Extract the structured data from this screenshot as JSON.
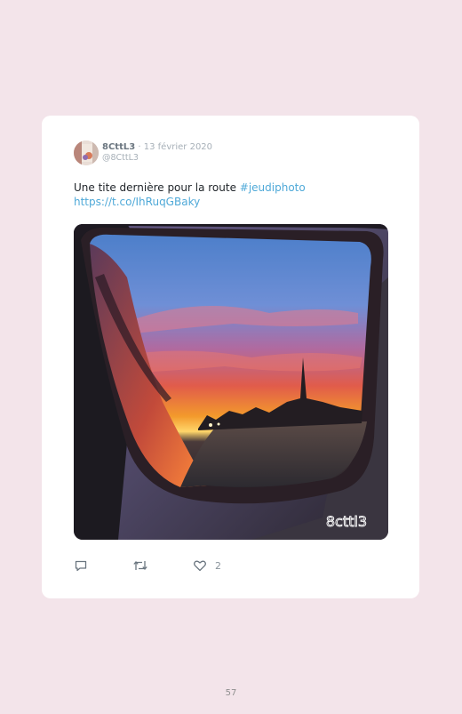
{
  "tweet": {
    "username": "8CttL3",
    "separator": "·",
    "date": "13 février 2020",
    "handle": "@8CttL3",
    "text": "Une tite dernière pour la route ",
    "hashtag": "#jeudiphoto",
    "link": "https://t.co/IhRuqGBaky",
    "image_watermark": "8cttl3",
    "like_count": "2"
  },
  "icons": {
    "reply": "reply-icon",
    "retweet": "retweet-icon",
    "like": "heart-icon"
  },
  "colors": {
    "page_background": "#f3e4ea",
    "card_background": "#ffffff",
    "link": "#4fa9d8",
    "muted_text": "#a7b0b8"
  },
  "page": {
    "number": "57"
  }
}
